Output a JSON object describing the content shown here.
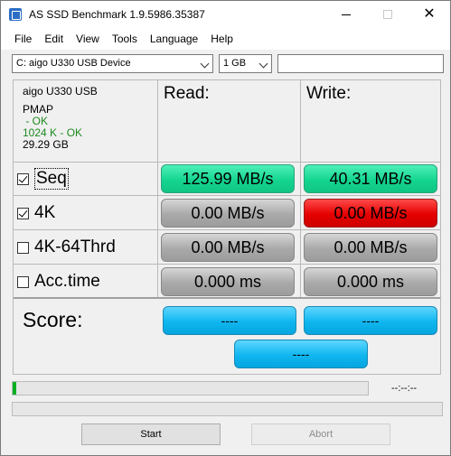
{
  "window": {
    "title": "AS SSD Benchmark 1.9.5986.35387",
    "controls": {
      "minimize": "—",
      "maximize": "☐",
      "close": "✕"
    }
  },
  "menu": [
    "File",
    "Edit",
    "View",
    "Tools",
    "Language",
    "Help"
  ],
  "toolbar": {
    "drive": "C: aigo U330 USB Device",
    "size": "1 GB",
    "input_value": ""
  },
  "drive_info": {
    "name": "aigo U330 USB",
    "line1": "PMAP",
    "line2": " - OK",
    "line3": "1024 K - OK",
    "line4": "29.29 GB"
  },
  "headers": {
    "read": "Read:",
    "write": "Write:"
  },
  "tests": [
    {
      "label": "Seq",
      "checked": true,
      "read": "125.99 MB/s",
      "write": "40.31 MB/s"
    },
    {
      "label": "4K",
      "checked": true,
      "read": "0.00 MB/s",
      "write": "0.00 MB/s"
    },
    {
      "label": "4K-64Thrd",
      "checked": false,
      "read": "0.00 MB/s",
      "write": "0.00 MB/s"
    },
    {
      "label": "Acc.time",
      "checked": false,
      "read": "0.000 ms",
      "write": "0.000 ms"
    }
  ],
  "score": {
    "label": "Score:",
    "read": "----",
    "write": "----",
    "total": "----"
  },
  "progress": {
    "percent": 1,
    "time": "--:--:--"
  },
  "buttons": {
    "start": "Start",
    "abort": "Abort"
  },
  "colors": {
    "green": "#14d590",
    "red": "#e40000",
    "gray": "#a9a9a9",
    "blue": "#10b6ef",
    "progress": "#06b025"
  }
}
